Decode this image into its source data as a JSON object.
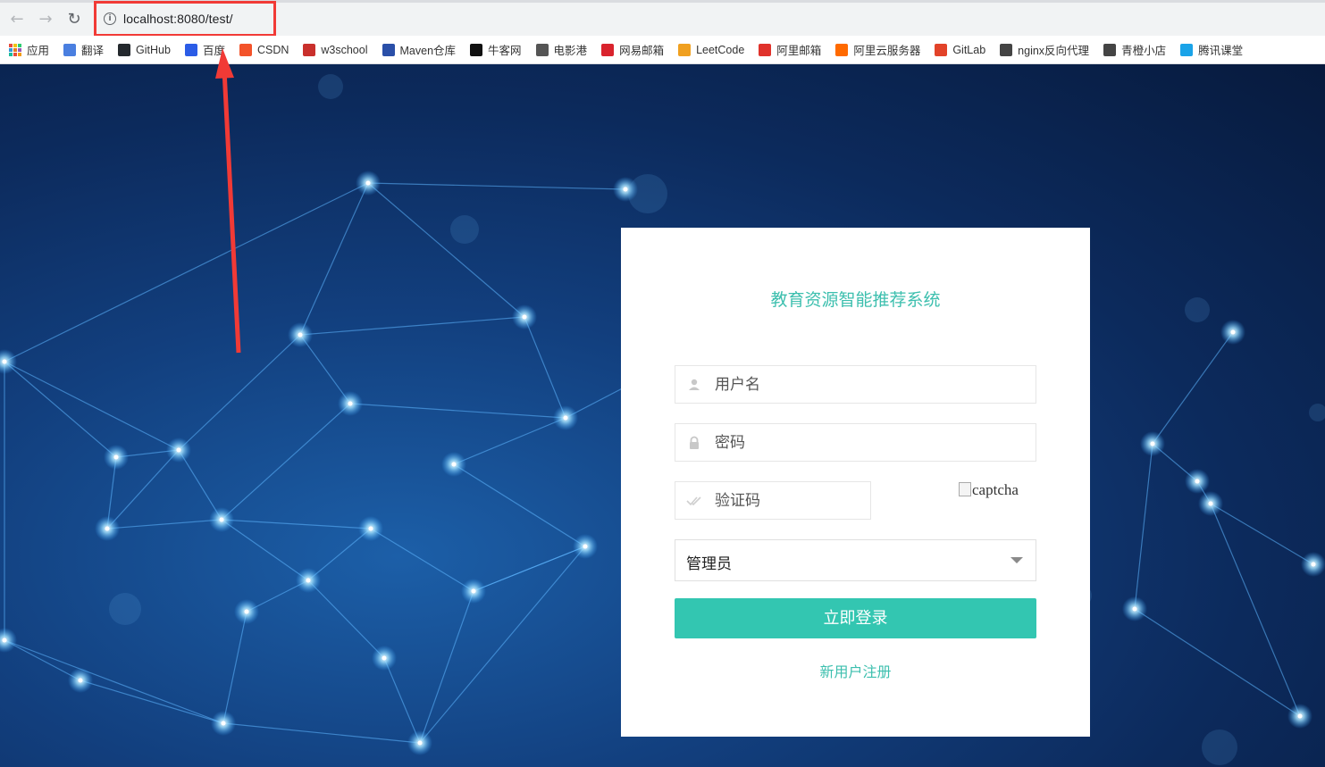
{
  "browser": {
    "url": "localhost:8080/test/",
    "bookmarks": [
      {
        "label": "应用",
        "icon": "apps-grid-icon",
        "color": "#e8a33a"
      },
      {
        "label": "翻译",
        "icon": "translate-icon",
        "color": "#4a7fe0"
      },
      {
        "label": "GitHub",
        "icon": "github-icon",
        "color": "#24292e"
      },
      {
        "label": "百度",
        "icon": "baidu-icon",
        "color": "#2b5ce6"
      },
      {
        "label": "CSDN",
        "icon": "csdn-icon",
        "color": "#f3532a"
      },
      {
        "label": "w3school",
        "icon": "w3school-icon",
        "color": "#c9302c"
      },
      {
        "label": "Maven仓库",
        "icon": "maven-icon",
        "color": "#2a4fa8"
      },
      {
        "label": "牛客网",
        "icon": "nowcoder-icon",
        "color": "#111111"
      },
      {
        "label": "电影港",
        "icon": "movie-icon",
        "color": "#555555"
      },
      {
        "label": "网易邮箱",
        "icon": "netease-mail-icon",
        "color": "#d9232d"
      },
      {
        "label": "LeetCode",
        "icon": "leetcode-icon",
        "color": "#f0a020"
      },
      {
        "label": "阿里邮箱",
        "icon": "ali-mail-icon",
        "color": "#e0322b"
      },
      {
        "label": "阿里云服务器",
        "icon": "aliyun-icon",
        "color": "#ff6a00"
      },
      {
        "label": "GitLab",
        "icon": "gitlab-icon",
        "color": "#e24329"
      },
      {
        "label": "nginx反向代理",
        "icon": "nginx-icon",
        "color": "#444444"
      },
      {
        "label": "青橙小店",
        "icon": "shop-icon",
        "color": "#444444"
      },
      {
        "label": "腾讯课堂",
        "icon": "tencent-class-icon",
        "color": "#1aa3e8"
      }
    ]
  },
  "login": {
    "title": "教育资源智能推荐系统",
    "username_placeholder": "用户名",
    "password_placeholder": "密码",
    "captcha_placeholder": "验证码",
    "captcha_alt": "captcha",
    "role_selected": "管理员",
    "submit_label": "立即登录",
    "register_link": "新用户注册"
  },
  "colors": {
    "accent": "#33c6b1",
    "title": "#3cbfae",
    "highlight": "#f13a36"
  }
}
